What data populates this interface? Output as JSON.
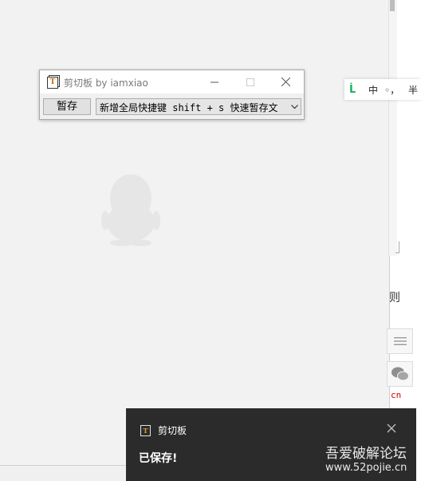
{
  "dialog": {
    "title": "剪切板 by iamxiao",
    "icon_letter": "T",
    "save_button": "暂存",
    "hotkey_select_value": "新增全局快捷键 shift + s 快速暂存文"
  },
  "ime": {
    "logo": "ᒫ",
    "mode": "中",
    "punct": "◦，",
    "width": "半"
  },
  "background": {
    "right_text": "则",
    "right_red": "cn"
  },
  "toast": {
    "icon_letter": "T",
    "title": "剪切板",
    "message": "已保存!"
  },
  "watermark": {
    "line1": "吾爱破解论坛",
    "line2": "www.52pojie.cn"
  },
  "icons": {
    "minimize": "minimize-icon",
    "maximize": "maximize-icon",
    "close": "close-icon",
    "dropdown": "chevron-down-icon",
    "menu": "menu-icon",
    "wechat": "wechat-icon",
    "penguin": "qq-penguin-icon"
  },
  "colors": {
    "ime_logo": "#1aad5c",
    "toast_bg": "#2b2b2b",
    "red_text": "#d60000"
  }
}
